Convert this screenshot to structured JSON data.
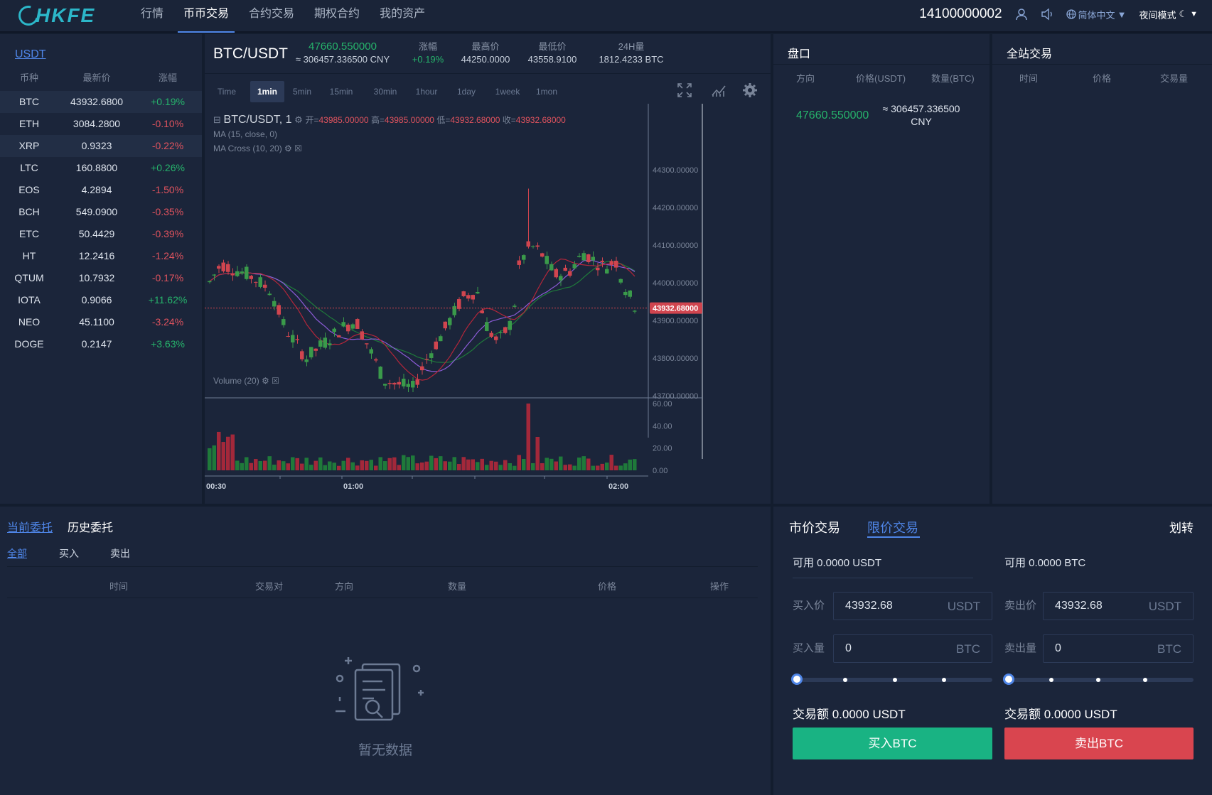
{
  "header": {
    "logo": "HKFE",
    "nav": [
      "行情",
      "币币交易",
      "合约交易",
      "期权合约",
      "我的资产"
    ],
    "active_nav": 1,
    "phone": "14100000002",
    "language": "简体中文",
    "night_mode": "夜间模式"
  },
  "market": {
    "tab": "USDT",
    "headers": [
      "币种",
      "最新价",
      "涨幅"
    ],
    "rows": [
      {
        "coin": "BTC",
        "price": "43932.6800",
        "change": "+0.19%",
        "dir": "up"
      },
      {
        "coin": "ETH",
        "price": "3084.2800",
        "change": "-0.10%",
        "dir": "down"
      },
      {
        "coin": "XRP",
        "price": "0.9323",
        "change": "-0.22%",
        "dir": "down"
      },
      {
        "coin": "LTC",
        "price": "160.8800",
        "change": "+0.26%",
        "dir": "up"
      },
      {
        "coin": "EOS",
        "price": "4.2894",
        "change": "-1.50%",
        "dir": "down"
      },
      {
        "coin": "BCH",
        "price": "549.0900",
        "change": "-0.35%",
        "dir": "down"
      },
      {
        "coin": "ETC",
        "price": "50.4429",
        "change": "-0.39%",
        "dir": "down"
      },
      {
        "coin": "HT",
        "price": "12.2416",
        "change": "-1.24%",
        "dir": "down"
      },
      {
        "coin": "QTUM",
        "price": "10.7932",
        "change": "-0.17%",
        "dir": "down"
      },
      {
        "coin": "IOTA",
        "price": "0.9066",
        "change": "+11.62%",
        "dir": "up"
      },
      {
        "coin": "NEO",
        "price": "45.1100",
        "change": "-3.24%",
        "dir": "down"
      },
      {
        "coin": "DOGE",
        "price": "0.2147",
        "change": "+3.63%",
        "dir": "up"
      }
    ]
  },
  "ticker": {
    "pair": "BTC/USDT",
    "price": "47660.550000",
    "cny": "≈ 306457.336500 CNY",
    "change_label": "涨幅",
    "change": "+0.19%",
    "high_label": "最高价",
    "high": "44250.0000",
    "low_label": "最低价",
    "low": "43558.9100",
    "vol_label": "24H量",
    "vol": "1812.4233 BTC"
  },
  "timeframes": [
    "Time",
    "1min",
    "5min",
    "15min",
    "30min",
    "1hour",
    "1day",
    "1week",
    "1mon"
  ],
  "active_tf": 1,
  "chart_legend": {
    "title": "BTC/USDT, 1",
    "open_label": "开=",
    "open": "43985.00000",
    "high_label": "高=",
    "high": "43985.00000",
    "low_label": "低=",
    "low": "43932.68000",
    "close_label": "收=",
    "close": "43932.68000",
    "ma": "MA (15, close, 0)",
    "macross": "MA Cross (10, 20)",
    "volume": "Volume (20)",
    "last_price_tag": "43932.68000"
  },
  "chart_data": {
    "type": "candlestick",
    "price_axis": [
      "44300.00000",
      "44200.00000",
      "44100.00000",
      "44000.00000",
      "43900.00000",
      "43800.00000",
      "43700.00000"
    ],
    "volume_axis": [
      "60.00",
      "40.00",
      "20.00",
      "0.00"
    ],
    "time_axis": [
      "00:30",
      "01:00",
      "02:00"
    ],
    "ylim": [
      43700,
      44300
    ],
    "volume_ylim": [
      0,
      60
    ]
  },
  "orderbook": {
    "title": "盘口",
    "headers": [
      "方向",
      "价格(USDT)",
      "数量(BTC)"
    ],
    "price": "47660.550000",
    "cny": "≈ 306457.336500",
    "cny_unit": "CNY"
  },
  "trades": {
    "title": "全站交易",
    "headers": [
      "时间",
      "价格",
      "交易量"
    ]
  },
  "orders": {
    "tabs": [
      "当前委托",
      "历史委托"
    ],
    "sub_tabs": [
      "全部",
      "买入",
      "卖出"
    ],
    "columns": [
      "时间",
      "交易对",
      "方向",
      "数量",
      "价格",
      "操作"
    ],
    "empty": "暂无数据"
  },
  "trade_form": {
    "tabs": [
      "市价交易",
      "限价交易"
    ],
    "transfer": "划转",
    "buy": {
      "avail": "可用 0.0000 USDT",
      "price_label": "买入价",
      "price": "43932.68",
      "price_unit": "USDT",
      "qty_label": "买入量",
      "qty": "0",
      "qty_unit": "BTC",
      "amount": "交易额 0.0000 USDT",
      "button": "买入BTC",
      "color": "#19b383"
    },
    "sell": {
      "avail": "可用 0.0000 BTC",
      "price_label": "卖出价",
      "price": "43932.68",
      "price_unit": "USDT",
      "qty_label": "卖出量",
      "qty": "0",
      "qty_unit": "BTC",
      "amount": "交易额 0.0000 USDT",
      "button": "卖出BTC",
      "color": "#d9454f"
    }
  }
}
